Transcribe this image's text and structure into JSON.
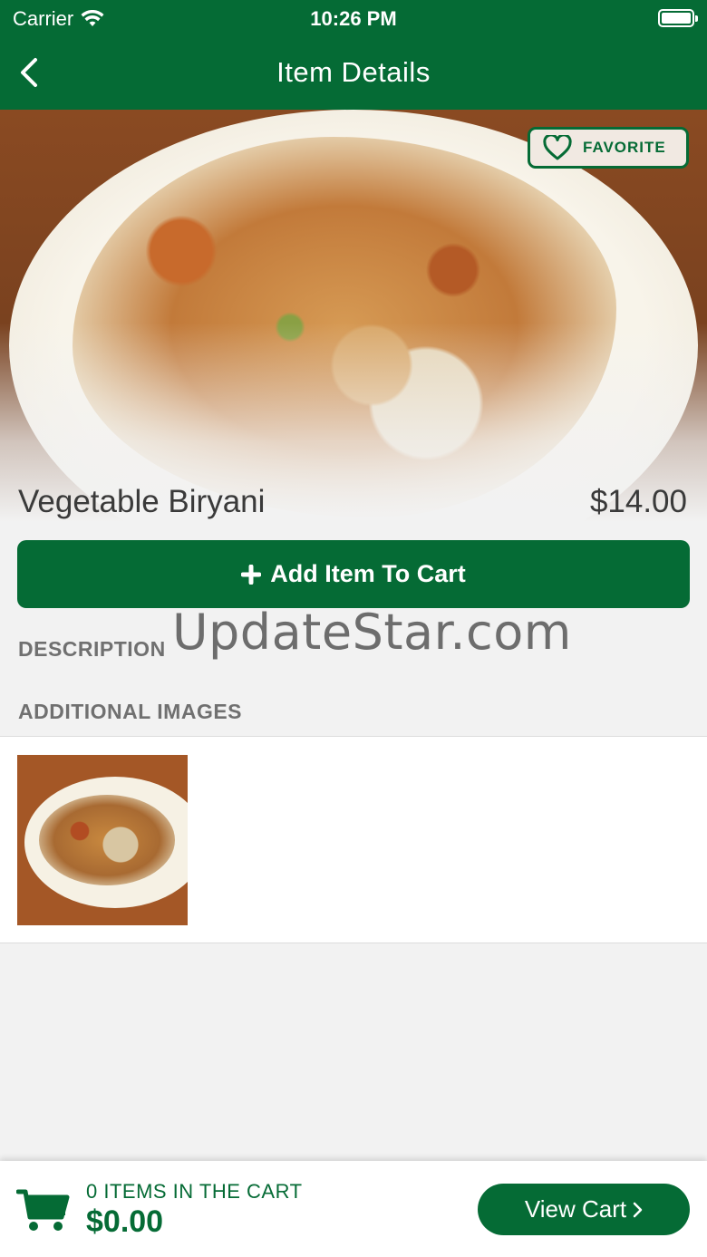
{
  "status_bar": {
    "carrier": "Carrier",
    "time": "10:26 PM"
  },
  "nav": {
    "title": "Item Details",
    "back_icon": "chevron-left-icon"
  },
  "item": {
    "favorite_label": "FAVORITE",
    "name": "Vegetable Biryani",
    "price": "$14.00",
    "add_to_cart_label": "Add Item To Cart"
  },
  "sections": {
    "description_label": "DESCRIPTION",
    "additional_images_label": "ADDITIONAL IMAGES"
  },
  "watermark": "UpdateStar.com",
  "cart": {
    "count_text": "0 ITEMS IN THE CART",
    "total": "$0.00",
    "view_cart_label": "View Cart"
  },
  "colors": {
    "brand_green": "#056b35",
    "background": "#f2f2f2"
  }
}
